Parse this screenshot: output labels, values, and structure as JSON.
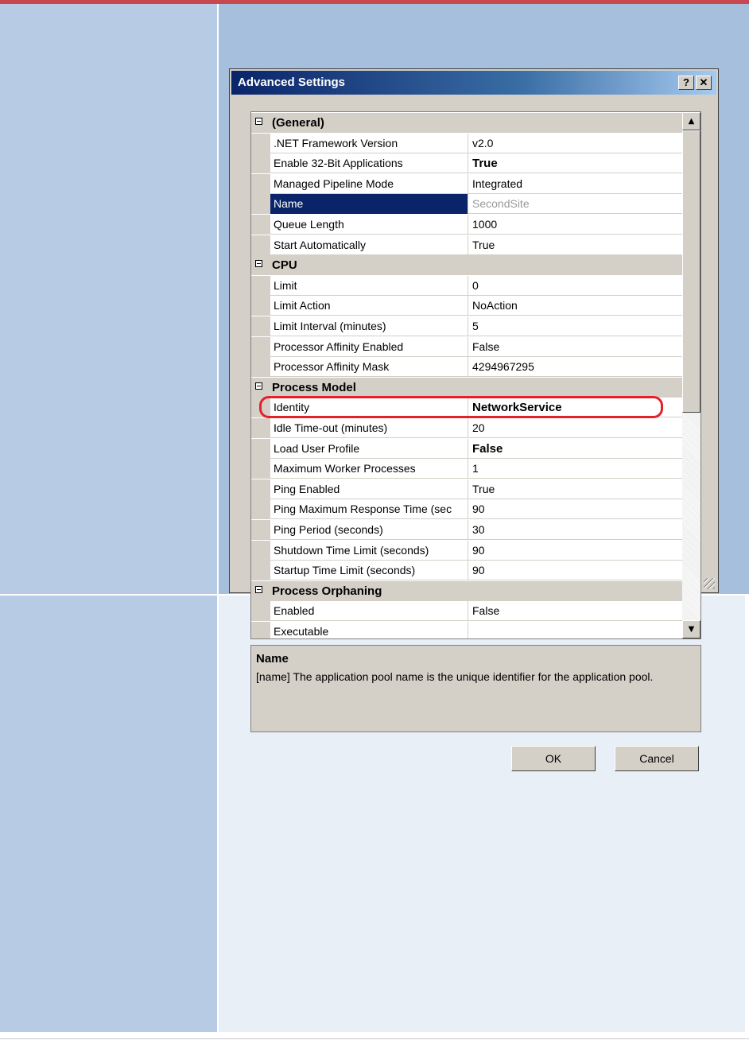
{
  "dialog": {
    "title": "Advanced Settings",
    "help_button": "?",
    "close_button": "✕"
  },
  "categories": [
    {
      "label": "(General)",
      "properties": [
        {
          "name": ".NET Framework Version",
          "value": "v2.0",
          "bold": false
        },
        {
          "name": "Enable 32-Bit Applications",
          "value": "True",
          "bold": true
        },
        {
          "name": "Managed Pipeline Mode",
          "value": "Integrated",
          "bold": false
        },
        {
          "name": "Name",
          "value": "SecondSite",
          "bold": false,
          "selected": true
        },
        {
          "name": "Queue Length",
          "value": "1000",
          "bold": false
        },
        {
          "name": "Start Automatically",
          "value": "True",
          "bold": false
        }
      ]
    },
    {
      "label": "CPU",
      "properties": [
        {
          "name": "Limit",
          "value": "0",
          "bold": false
        },
        {
          "name": "Limit Action",
          "value": "NoAction",
          "bold": false
        },
        {
          "name": "Limit Interval (minutes)",
          "value": "5",
          "bold": false
        },
        {
          "name": "Processor Affinity Enabled",
          "value": "False",
          "bold": false
        },
        {
          "name": "Processor Affinity Mask",
          "value": "4294967295",
          "bold": false
        }
      ]
    },
    {
      "label": "Process Model",
      "properties": [
        {
          "name": "Identity",
          "value": "NetworkService",
          "bold": true,
          "highlighted": true
        },
        {
          "name": "Idle Time-out (minutes)",
          "value": "20",
          "bold": false
        },
        {
          "name": "Load User Profile",
          "value": "False",
          "bold": true
        },
        {
          "name": "Maximum Worker Processes",
          "value": "1",
          "bold": false
        },
        {
          "name": "Ping Enabled",
          "value": "True",
          "bold": false
        },
        {
          "name": "Ping Maximum Response Time (sec",
          "value": "90",
          "bold": false
        },
        {
          "name": "Ping Period (seconds)",
          "value": "30",
          "bold": false
        },
        {
          "name": "Shutdown Time Limit (seconds)",
          "value": "90",
          "bold": false
        },
        {
          "name": "Startup Time Limit (seconds)",
          "value": "90",
          "bold": false
        }
      ]
    },
    {
      "label": "Process Orphaning",
      "properties": [
        {
          "name": "Enabled",
          "value": "False",
          "bold": false
        },
        {
          "name": "Executable",
          "value": "",
          "bold": false
        }
      ]
    }
  ],
  "description": {
    "title": "Name",
    "text": "[name] The application pool name is the unique identifier for the application pool."
  },
  "buttons": {
    "ok": "OK",
    "cancel": "Cancel"
  },
  "colors": {
    "title_bar_start": "#0a246a",
    "selection": "#0a246a",
    "highlight_ring": "#e3212a",
    "dialog_face": "#d4d0c8",
    "page_top_rule": "#c9474f"
  },
  "icons": {
    "scroll_up": "▲",
    "scroll_down": "▼"
  }
}
